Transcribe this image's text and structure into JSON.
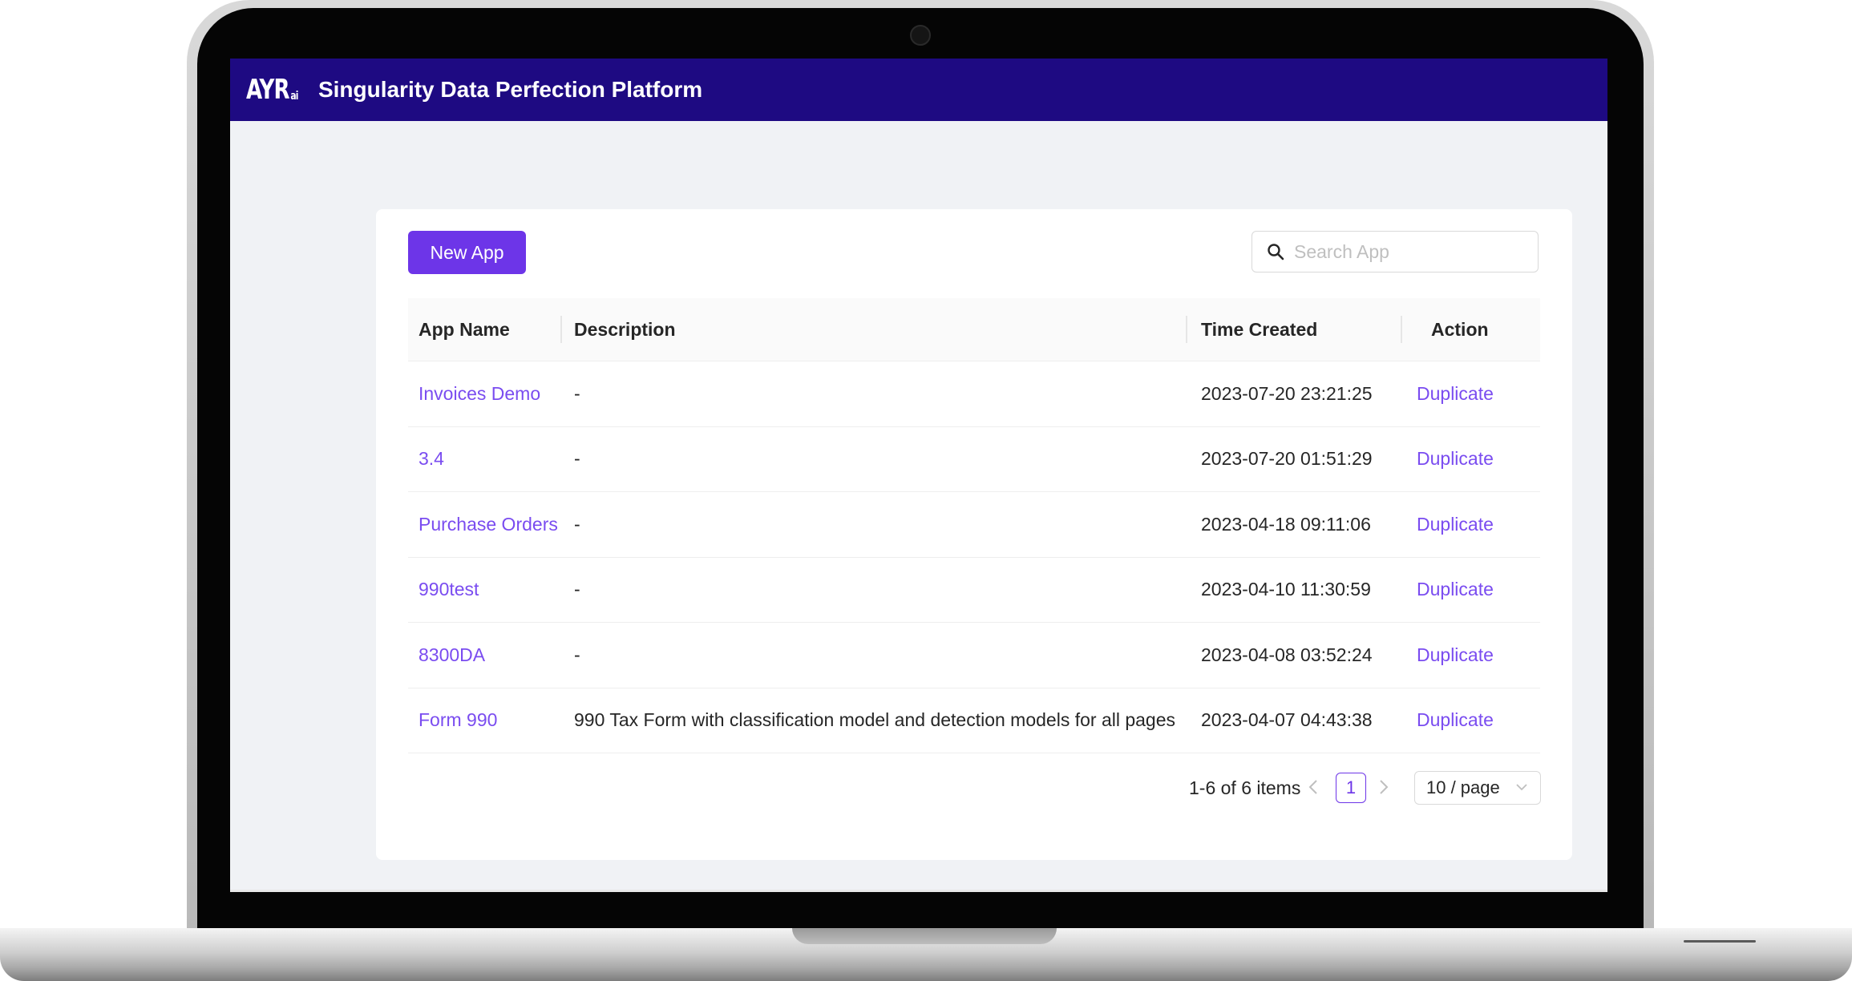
{
  "header": {
    "logo_text": "AYR",
    "logo_suffix": "ai",
    "title": "Singularity Data Perfection Platform"
  },
  "toolbar": {
    "new_app_label": "New App",
    "search_placeholder": "Search App",
    "search_value": ""
  },
  "table": {
    "columns": [
      "App Name",
      "Description",
      "Time Created",
      "Action"
    ],
    "rows": [
      {
        "name": "Invoices Demo",
        "description": "-",
        "time_created": "2023-07-20 23:21:25",
        "action": "Duplicate"
      },
      {
        "name": "3.4",
        "description": "-",
        "time_created": "2023-07-20 01:51:29",
        "action": "Duplicate"
      },
      {
        "name": "Purchase Orders",
        "description": "-",
        "time_created": "2023-04-18 09:11:06",
        "action": "Duplicate"
      },
      {
        "name": "990test",
        "description": "-",
        "time_created": "2023-04-10 11:30:59",
        "action": "Duplicate"
      },
      {
        "name": "8300DA",
        "description": "-",
        "time_created": "2023-04-08 03:52:24",
        "action": "Duplicate"
      },
      {
        "name": "Form 990",
        "description": "990 Tax Form with classification model and detection models for all pages",
        "time_created": "2023-04-07 04:43:38",
        "action": "Duplicate"
      }
    ]
  },
  "pagination": {
    "total_text": "1-6 of 6 items",
    "current_page": "1",
    "page_size": "10 / page"
  },
  "colors": {
    "header_bg": "#1e0a82",
    "primary": "#6d35e8",
    "link": "#7a4cf0"
  }
}
